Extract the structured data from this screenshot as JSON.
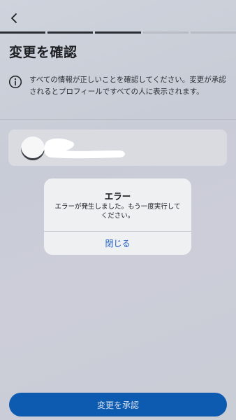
{
  "header": {
    "back_icon": "chevron-left-icon",
    "progress": {
      "total_steps": 5,
      "current_step": 3
    }
  },
  "title": "変更を確認",
  "info": {
    "icon": "info-icon",
    "text": "すべての情報が正しいことを確認してください。変更が承認されるとプロフィールですべての人に表示されます。"
  },
  "profile_card": {
    "avatar": "avatar",
    "name_redacted": true
  },
  "alert": {
    "title": "エラー",
    "message": "エラーが発生しました。もう一度実行してください。",
    "button_label": "閉じる"
  },
  "footer": {
    "approve_label": "変更を承認"
  },
  "colors": {
    "primary": "#0d5bb0",
    "link": "#2360c4"
  }
}
